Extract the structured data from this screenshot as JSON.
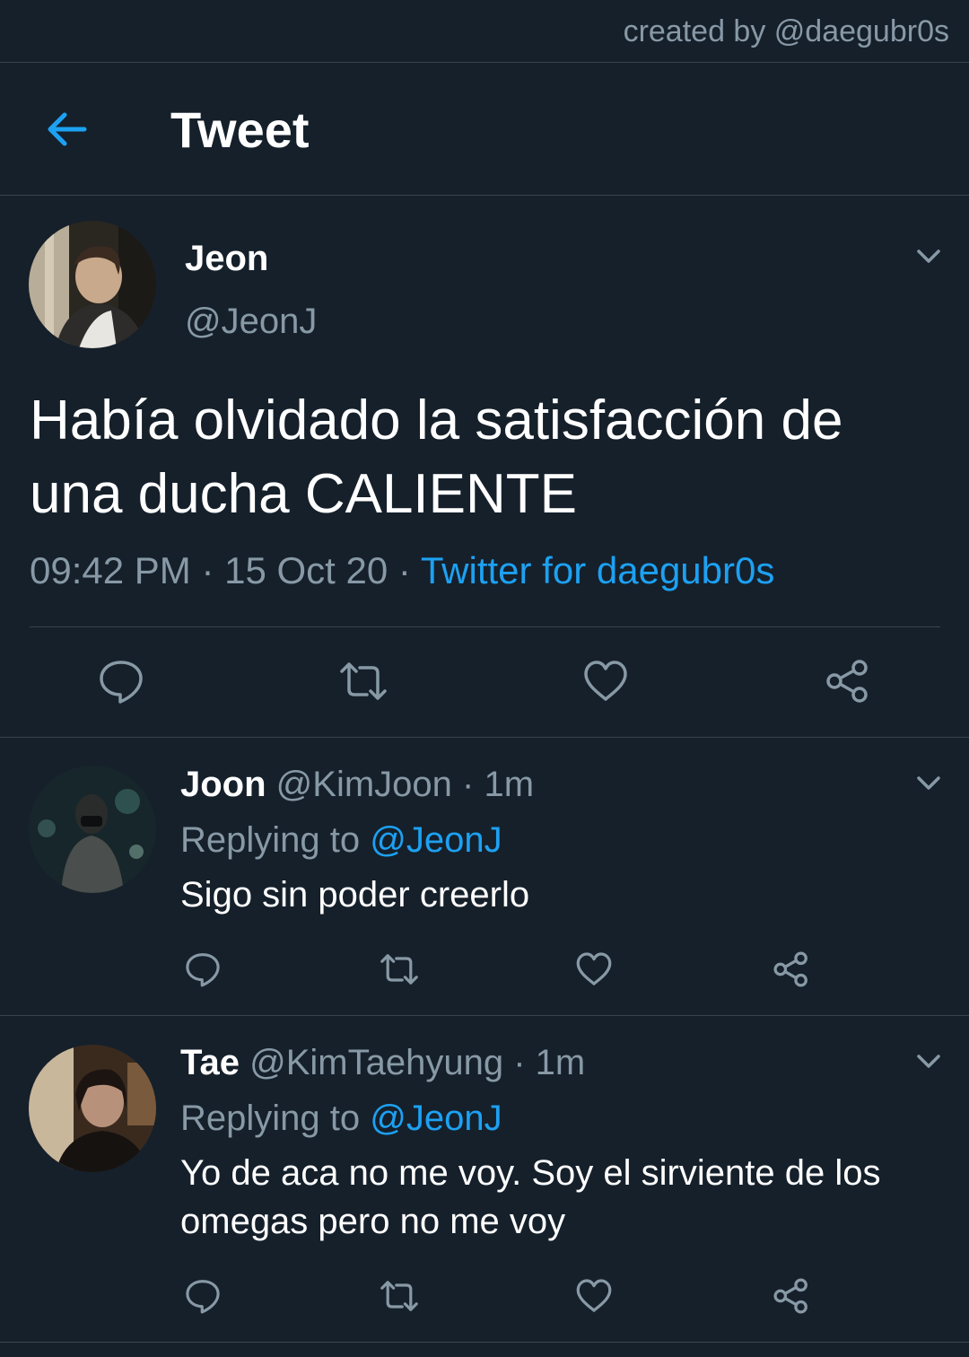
{
  "credit": "created by @daegubr0s",
  "header": {
    "title": "Tweet",
    "back_icon": "arrow-left-icon"
  },
  "colors": {
    "background": "#15202b",
    "accent": "#1da1f2",
    "muted": "#8899a6",
    "divider": "#38444d"
  },
  "tweet": {
    "name": "Jeon",
    "handle": "@JeonJ",
    "text": "Había olvidado la satisfacción de una ducha CALIENTE",
    "time": "09:42 PM",
    "sep1": "·",
    "date": "15 Oct 20",
    "sep2": "·",
    "source": "Twitter for daegubr0s",
    "actions": [
      "reply-icon",
      "retweet-icon",
      "like-icon",
      "share-icon"
    ]
  },
  "replies": [
    {
      "name": "Joon",
      "handle": "@KimJoon",
      "sep": "·",
      "age": "1m",
      "replying_prefix": "Replying to",
      "mention": "@JeonJ",
      "text": "Sigo sin poder creerlo"
    },
    {
      "name": "Tae",
      "handle": "@KimTaehyung",
      "sep": "·",
      "age": "1m",
      "replying_prefix": "Replying to",
      "mention": "@JeonJ",
      "text": "Yo de aca no me voy. Soy el sirviente de los omegas pero no me voy"
    }
  ]
}
